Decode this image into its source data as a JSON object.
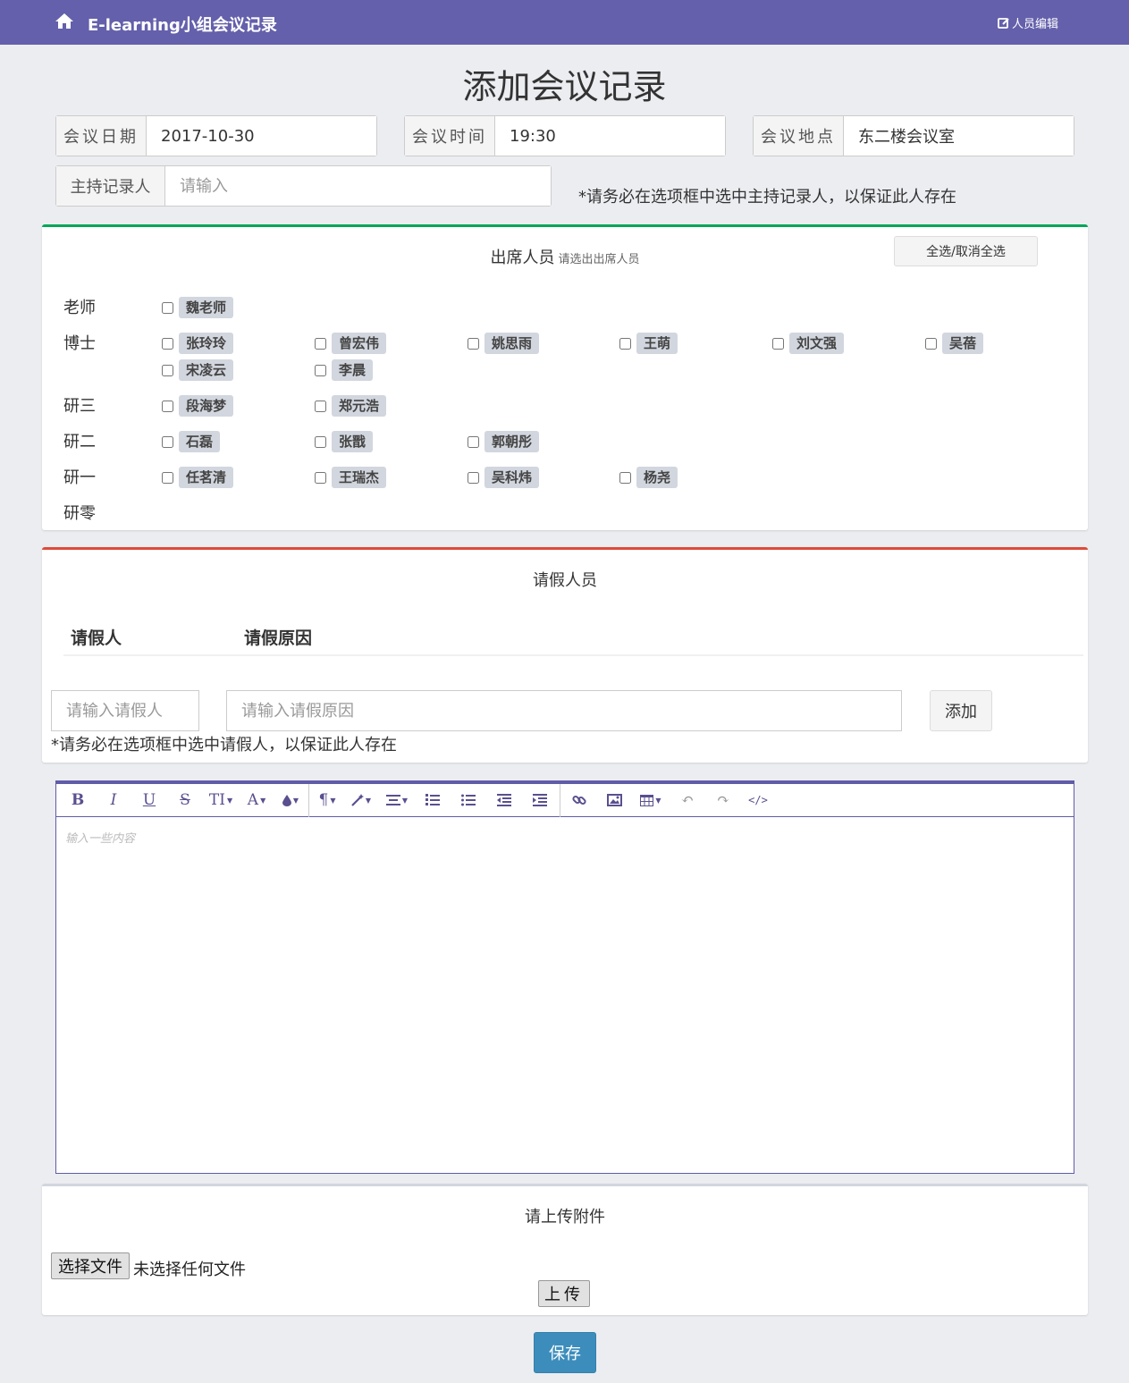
{
  "navbar": {
    "brand": "E-learning小组会议记录",
    "edit_link": "人员编辑",
    "home_icon": "home-icon",
    "edit_icon": "edit-icon",
    "bg": "#6460ab"
  },
  "page_title": "添加会议记录",
  "form": {
    "date_label": "会议日期",
    "date_value": "2017-10-30",
    "time_label": "会议时间",
    "time_value": "19:30",
    "place_label": "会议地点",
    "place_value": "东二楼会议室",
    "host_label": "主持记录人",
    "host_placeholder": "请输入",
    "host_hint": "*请务必在选项框中选中主持记录人，以保证此人存在"
  },
  "attendance": {
    "title": "出席人员",
    "subtitle": "请选出出席人员",
    "select_all": "全选/取消全选",
    "accent": "#00a65a",
    "groups": [
      {
        "label": "老师",
        "members": [
          "魏老师"
        ]
      },
      {
        "label": "博士",
        "members": [
          "张玲玲",
          "曾宏伟",
          "姚思雨",
          "王萌",
          "刘文强",
          "吴蓓",
          "宋凌云",
          "李晨"
        ]
      },
      {
        "label": "研三",
        "members": [
          "段海梦",
          "郑元浩"
        ]
      },
      {
        "label": "研二",
        "members": [
          "石磊",
          "张戬",
          "郭朝彤"
        ]
      },
      {
        "label": "研一",
        "members": [
          "任茗清",
          "王瑞杰",
          "吴科炜",
          "杨尧"
        ]
      },
      {
        "label": "研零",
        "members": []
      }
    ]
  },
  "leave": {
    "title": "请假人员",
    "accent": "#dd4b39",
    "col_person": "请假人",
    "col_reason": "请假原因",
    "person_placeholder": "请输入请假人",
    "reason_placeholder": "请输入请假原因",
    "add_button": "添加",
    "hint": "*请务必在选项框中选中请假人，以保证此人存在"
  },
  "editor": {
    "placeholder": "输入一些内容",
    "toolbar": [
      "bold-icon",
      "italic-icon",
      "underline-icon",
      "strikethrough-icon",
      "font-size-icon",
      "font-color-icon",
      "background-color-icon",
      "paragraph-icon",
      "magic-wand-icon",
      "align-icon",
      "ordered-list-icon",
      "unordered-list-icon",
      "outdent-icon",
      "indent-icon",
      "link-icon",
      "image-icon",
      "table-icon",
      "undo-icon",
      "redo-icon",
      "code-view-icon"
    ],
    "toolbar_glyphs": {
      "bold": "B",
      "italic": "I",
      "underline": "U",
      "strike": "S",
      "font_size": "TI",
      "font_color": "A",
      "paragraph": "¶"
    }
  },
  "upload": {
    "title": "请上传附件",
    "choose_button": "选择文件",
    "file_status": "未选择任何文件",
    "upload_button": "上传"
  },
  "save_button": "保存"
}
